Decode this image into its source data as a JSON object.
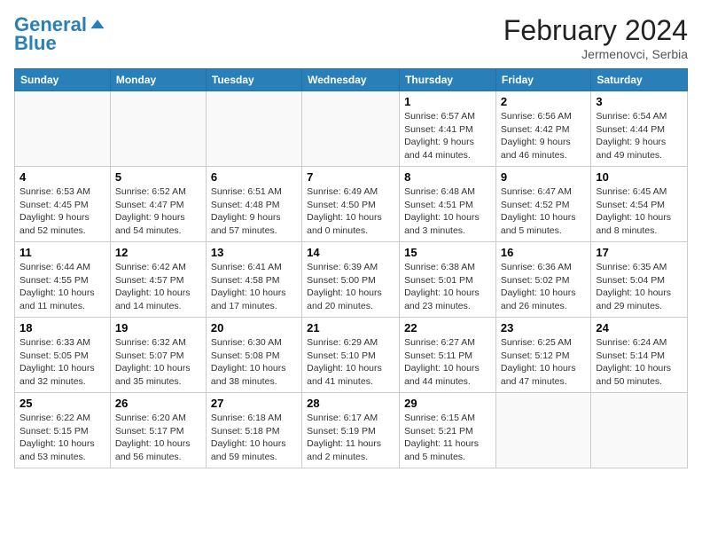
{
  "header": {
    "logo_line1": "General",
    "logo_line2": "Blue",
    "month": "February 2024",
    "location": "Jermenovci, Serbia"
  },
  "weekdays": [
    "Sunday",
    "Monday",
    "Tuesday",
    "Wednesday",
    "Thursday",
    "Friday",
    "Saturday"
  ],
  "weeks": [
    [
      {
        "day": "",
        "info": ""
      },
      {
        "day": "",
        "info": ""
      },
      {
        "day": "",
        "info": ""
      },
      {
        "day": "",
        "info": ""
      },
      {
        "day": "1",
        "sunrise": "6:57 AM",
        "sunset": "4:41 PM",
        "daylight": "9 hours and 44 minutes."
      },
      {
        "day": "2",
        "sunrise": "6:56 AM",
        "sunset": "4:42 PM",
        "daylight": "9 hours and 46 minutes."
      },
      {
        "day": "3",
        "sunrise": "6:54 AM",
        "sunset": "4:44 PM",
        "daylight": "9 hours and 49 minutes."
      }
    ],
    [
      {
        "day": "4",
        "sunrise": "6:53 AM",
        "sunset": "4:45 PM",
        "daylight": "9 hours and 52 minutes."
      },
      {
        "day": "5",
        "sunrise": "6:52 AM",
        "sunset": "4:47 PM",
        "daylight": "9 hours and 54 minutes."
      },
      {
        "day": "6",
        "sunrise": "6:51 AM",
        "sunset": "4:48 PM",
        "daylight": "9 hours and 57 minutes."
      },
      {
        "day": "7",
        "sunrise": "6:49 AM",
        "sunset": "4:50 PM",
        "daylight": "10 hours and 0 minutes."
      },
      {
        "day": "8",
        "sunrise": "6:48 AM",
        "sunset": "4:51 PM",
        "daylight": "10 hours and 3 minutes."
      },
      {
        "day": "9",
        "sunrise": "6:47 AM",
        "sunset": "4:52 PM",
        "daylight": "10 hours and 5 minutes."
      },
      {
        "day": "10",
        "sunrise": "6:45 AM",
        "sunset": "4:54 PM",
        "daylight": "10 hours and 8 minutes."
      }
    ],
    [
      {
        "day": "11",
        "sunrise": "6:44 AM",
        "sunset": "4:55 PM",
        "daylight": "10 hours and 11 minutes."
      },
      {
        "day": "12",
        "sunrise": "6:42 AM",
        "sunset": "4:57 PM",
        "daylight": "10 hours and 14 minutes."
      },
      {
        "day": "13",
        "sunrise": "6:41 AM",
        "sunset": "4:58 PM",
        "daylight": "10 hours and 17 minutes."
      },
      {
        "day": "14",
        "sunrise": "6:39 AM",
        "sunset": "5:00 PM",
        "daylight": "10 hours and 20 minutes."
      },
      {
        "day": "15",
        "sunrise": "6:38 AM",
        "sunset": "5:01 PM",
        "daylight": "10 hours and 23 minutes."
      },
      {
        "day": "16",
        "sunrise": "6:36 AM",
        "sunset": "5:02 PM",
        "daylight": "10 hours and 26 minutes."
      },
      {
        "day": "17",
        "sunrise": "6:35 AM",
        "sunset": "5:04 PM",
        "daylight": "10 hours and 29 minutes."
      }
    ],
    [
      {
        "day": "18",
        "sunrise": "6:33 AM",
        "sunset": "5:05 PM",
        "daylight": "10 hours and 32 minutes."
      },
      {
        "day": "19",
        "sunrise": "6:32 AM",
        "sunset": "5:07 PM",
        "daylight": "10 hours and 35 minutes."
      },
      {
        "day": "20",
        "sunrise": "6:30 AM",
        "sunset": "5:08 PM",
        "daylight": "10 hours and 38 minutes."
      },
      {
        "day": "21",
        "sunrise": "6:29 AM",
        "sunset": "5:10 PM",
        "daylight": "10 hours and 41 minutes."
      },
      {
        "day": "22",
        "sunrise": "6:27 AM",
        "sunset": "5:11 PM",
        "daylight": "10 hours and 44 minutes."
      },
      {
        "day": "23",
        "sunrise": "6:25 AM",
        "sunset": "5:12 PM",
        "daylight": "10 hours and 47 minutes."
      },
      {
        "day": "24",
        "sunrise": "6:24 AM",
        "sunset": "5:14 PM",
        "daylight": "10 hours and 50 minutes."
      }
    ],
    [
      {
        "day": "25",
        "sunrise": "6:22 AM",
        "sunset": "5:15 PM",
        "daylight": "10 hours and 53 minutes."
      },
      {
        "day": "26",
        "sunrise": "6:20 AM",
        "sunset": "5:17 PM",
        "daylight": "10 hours and 56 minutes."
      },
      {
        "day": "27",
        "sunrise": "6:18 AM",
        "sunset": "5:18 PM",
        "daylight": "10 hours and 59 minutes."
      },
      {
        "day": "28",
        "sunrise": "6:17 AM",
        "sunset": "5:19 PM",
        "daylight": "11 hours and 2 minutes."
      },
      {
        "day": "29",
        "sunrise": "6:15 AM",
        "sunset": "5:21 PM",
        "daylight": "11 hours and 5 minutes."
      },
      {
        "day": "",
        "info": ""
      },
      {
        "day": "",
        "info": ""
      }
    ]
  ]
}
